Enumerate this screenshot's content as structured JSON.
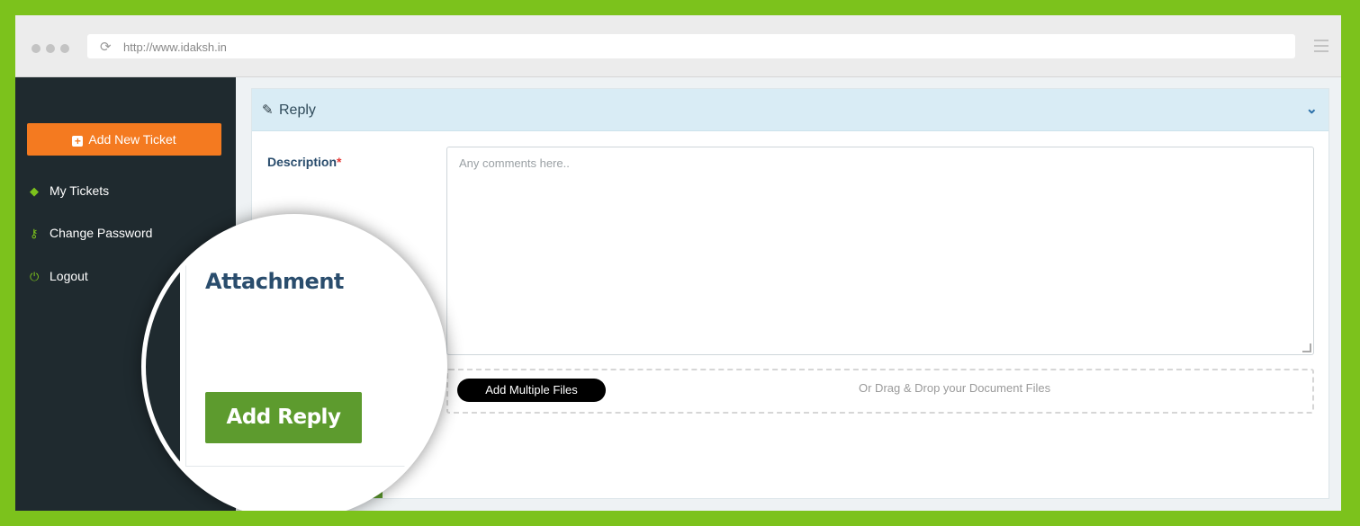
{
  "browser": {
    "url": "http://www.idaksh.in"
  },
  "sidebar": {
    "add_ticket_label": "Add New Ticket",
    "items": [
      {
        "label": "My Tickets",
        "icon": "ticket-icon"
      },
      {
        "label": "Change Password",
        "icon": "key-icon"
      },
      {
        "label": "Logout",
        "icon": "power-icon"
      }
    ]
  },
  "panel": {
    "title": "Reply",
    "description_label": "Description",
    "required_mark": "*",
    "description_placeholder": "Any comments here..",
    "add_files_label": "Add Multiple Files",
    "drop_text": "Or Drag & Drop your Document Files"
  },
  "magnified": {
    "attachment_label": "Attachment",
    "add_reply_label": "Add Reply"
  },
  "colors": {
    "frame": "#7cc21c",
    "sidebar": "#1f2a2f",
    "accent_orange": "#f47a20",
    "panel_header": "#d9ecf5",
    "button_green": "#5d9b2e"
  }
}
